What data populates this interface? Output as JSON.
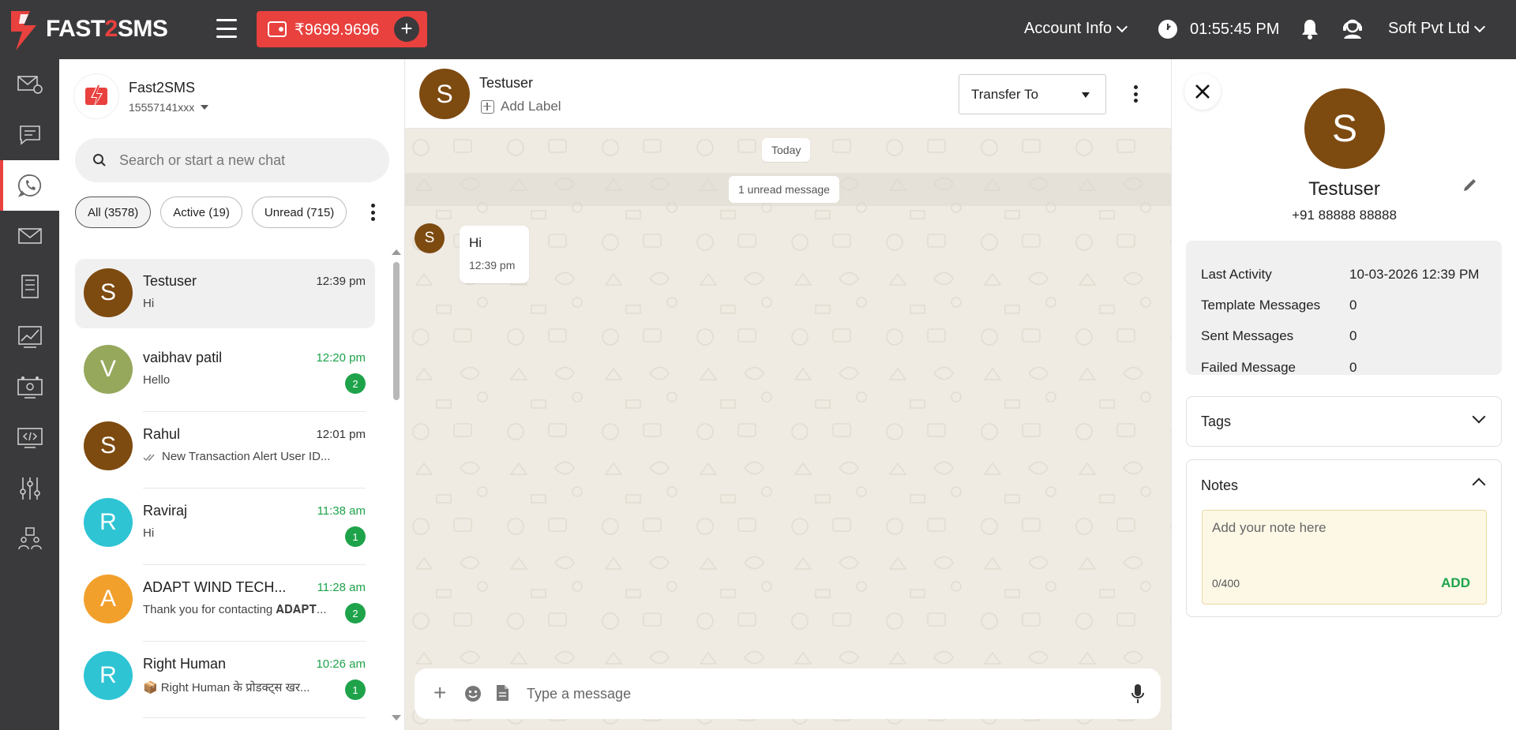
{
  "brand": {
    "logo_text_a": "FAST",
    "logo_text_b": "2",
    "logo_text_c": "SMS"
  },
  "topbar": {
    "wallet_balance": "₹9699.9696",
    "account_info": "Account Info",
    "time": "01:55:45 PM",
    "company": "Soft Pvt Ltd"
  },
  "sidebar_nav": [
    "bulk-sms",
    "messages",
    "whatsapp",
    "email",
    "reports",
    "analytics",
    "dev-api",
    "code",
    "settings",
    "team"
  ],
  "account": {
    "name": "Fast2SMS",
    "number": "15557141xxx"
  },
  "search": {
    "placeholder": "Search or start a new chat"
  },
  "filters": [
    {
      "label": "All (3578)",
      "active": true
    },
    {
      "label": "Active (19)",
      "active": false
    },
    {
      "label": "Unread (715)",
      "active": false
    }
  ],
  "chats": [
    {
      "initial": "S",
      "color": "#7d4a10",
      "name": "Testuser",
      "time": "12:39 pm",
      "time_green": false,
      "preview": "Hi",
      "badge": "",
      "ticks": false,
      "emoji": ""
    },
    {
      "initial": "V",
      "color": "#96a85c",
      "name": "vaibhav patil",
      "time": "12:20 pm",
      "time_green": true,
      "preview": "Hello",
      "badge": "2",
      "ticks": false,
      "emoji": ""
    },
    {
      "initial": "S",
      "color": "#7d4a10",
      "name": "Rahul",
      "time": "12:01 pm",
      "time_green": false,
      "preview": "New Transaction Alert User ID...",
      "badge": "",
      "ticks": true,
      "emoji": ""
    },
    {
      "initial": "R",
      "color": "#2ec4d4",
      "name": "Raviraj",
      "time": "11:38 am",
      "time_green": true,
      "preview": "Hi",
      "badge": "1",
      "ticks": false,
      "emoji": ""
    },
    {
      "initial": "A",
      "color": "#f2a02c",
      "name": "ADAPT WIND TECH...",
      "time": "11:28 am",
      "time_green": true,
      "preview": "Thank you for contacting 𝐀𝐃𝐀𝐏𝐓...",
      "badge": "2",
      "ticks": false,
      "emoji": ""
    },
    {
      "initial": "R",
      "color": "#2ec4d4",
      "name": "Right Human",
      "time": "10:26 am",
      "time_green": true,
      "preview": "Right Human के प्रोडक्ट्स खर...",
      "badge": "1",
      "ticks": false,
      "emoji": "📦"
    }
  ],
  "conversation": {
    "contact_initial": "S",
    "contact_name": "Testuser",
    "add_label": "Add Label",
    "transfer_to": "Transfer To",
    "date_chip": "Today",
    "unread_chip": "1 unread message",
    "messages": [
      {
        "sender_initial": "S",
        "text": "Hi",
        "time": "12:39 pm"
      }
    ],
    "composer_placeholder": "Type a message"
  },
  "contact_panel": {
    "initial": "S",
    "name": "Testuser",
    "phone": "+91 88888 88888",
    "stats": [
      {
        "label": "Last Activity",
        "value": "10-03-2026 12:39 PM"
      },
      {
        "label": "Template Messages",
        "value": "0"
      },
      {
        "label": "Sent Messages",
        "value": "0"
      },
      {
        "label": "Failed Message",
        "value": "0"
      }
    ],
    "tags_title": "Tags",
    "notes_title": "Notes",
    "notes_placeholder": "Add your note here",
    "notes_count": "0/400",
    "notes_add": "ADD"
  },
  "colors": {
    "brand_red": "#e8413e",
    "topbar": "#3a3a3c",
    "green": "#1ea34a",
    "chat_bg": "#efeae2"
  }
}
